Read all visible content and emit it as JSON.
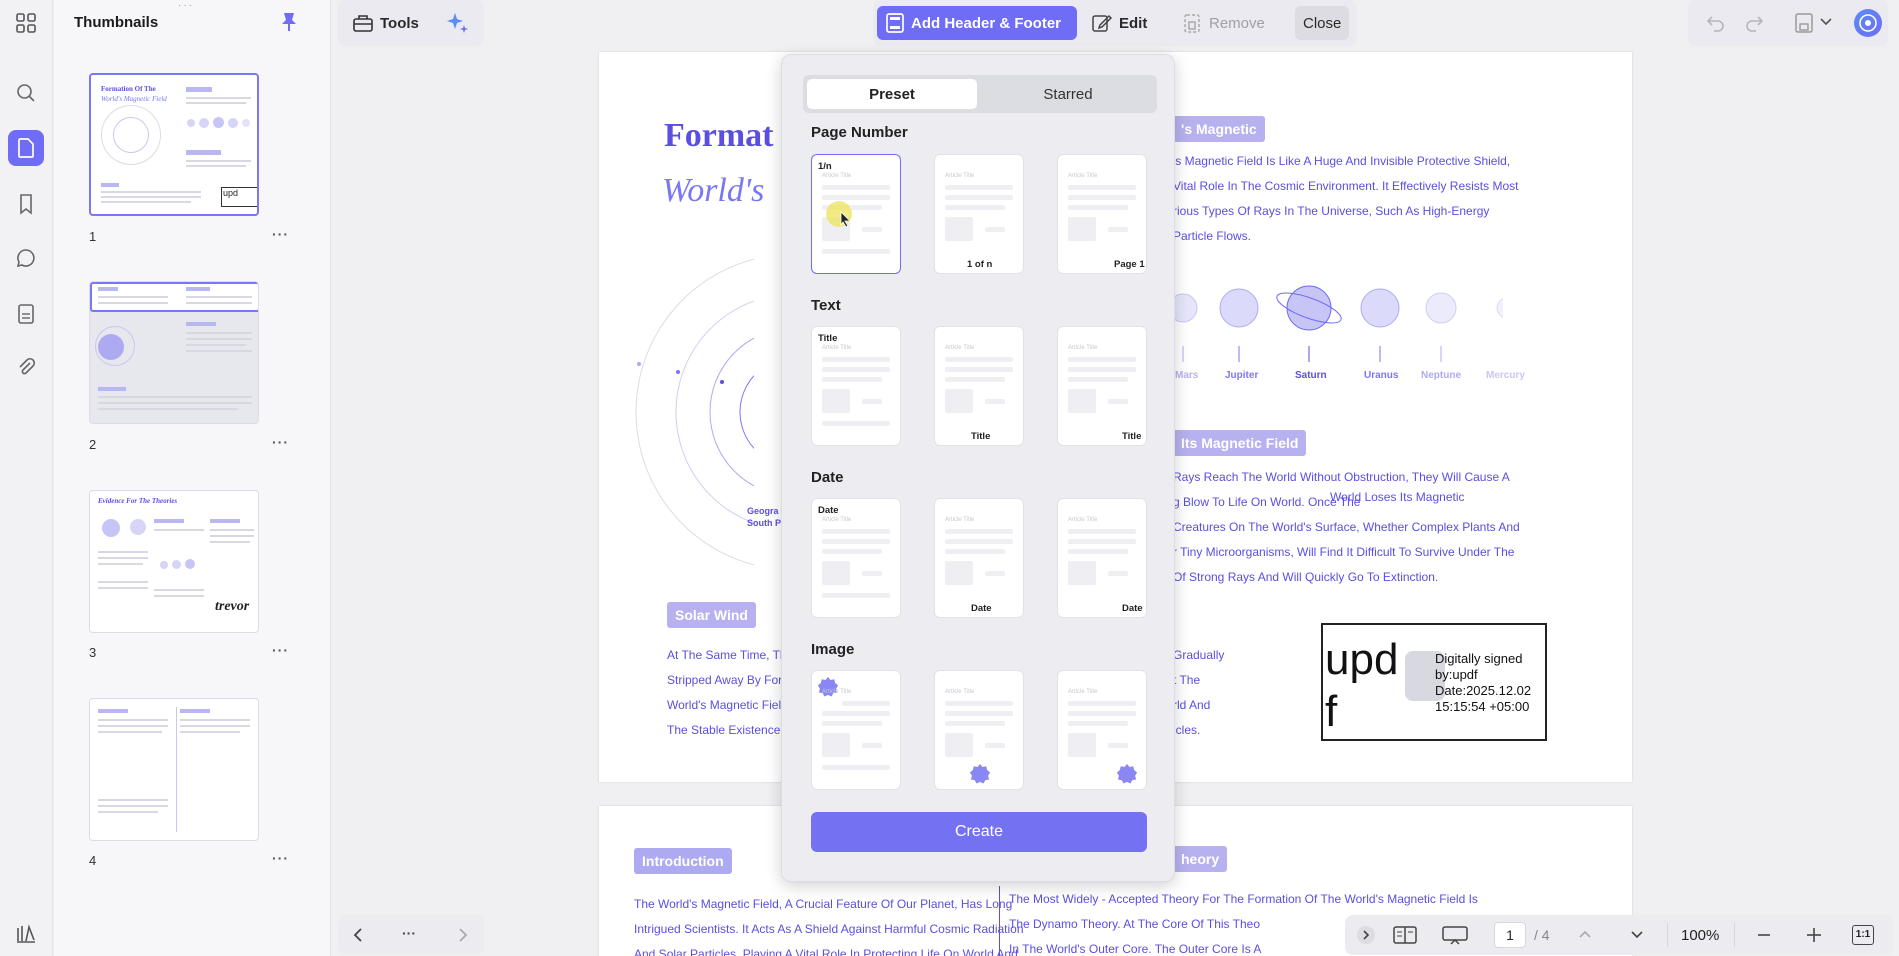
{
  "sidebar": {
    "title": "Thumbnails",
    "pages": [
      {
        "number": "1",
        "more": "···",
        "heading1": "Formation Of The",
        "heading2": "World's Magnetic Field"
      },
      {
        "number": "2",
        "more": "···"
      },
      {
        "number": "3",
        "more": "···",
        "heading": "Evidence For The Theories",
        "signature": "trevor"
      },
      {
        "number": "4",
        "more": "···"
      }
    ]
  },
  "toolbar": {
    "tools_label": "Tools",
    "add_header_footer_label": "Add Header & Footer",
    "edit_label": "Edit",
    "remove_label": "Remove",
    "close_label": "Close"
  },
  "panel": {
    "tabs": [
      "Preset",
      "Starred"
    ],
    "sections": [
      {
        "title": "Page Number",
        "captions": [
          "1/n",
          "1 of n",
          "Page 1"
        ]
      },
      {
        "title": "Text",
        "captions": [
          "Title",
          "Title",
          "Title"
        ]
      },
      {
        "title": "Date",
        "captions": [
          "Date",
          "Date",
          "Date"
        ]
      },
      {
        "title": "Image",
        "captions": [
          "",
          "",
          ""
        ]
      }
    ],
    "card_placeholder": "Article Title",
    "create_label": "Create"
  },
  "document": {
    "title1": "Format",
    "title2": "World's",
    "heading_magnetic": "'s Magnetic",
    "para1": [
      "'s Magnetic Field Is Like A Huge And Invisible Protective Shield,",
      "Vital Role In The Cosmic Environment. It Effectively Resists Most",
      "rious Types Of Rays In The Universe, Such As High-Energy",
      "Particle Flows."
    ],
    "planets": [
      "Mars",
      "Jupiter",
      "Saturn",
      "Uranus",
      "Neptune",
      "Mercury"
    ],
    "heading_field": "Its Magnetic Field",
    "para2": [
      "Rays Reach The World Without Obstruction, They Will Cause A",
      "g Blow To Life On World. Once The",
      "World Loses Its Magnetic",
      "Creatures On The World's Surface, Whether Complex Plants And",
      "r Tiny Microorganisms, Will Find It Difficult To Survive Under The",
      "Of Strong Rays And Will Quickly Go To Extinction."
    ],
    "geo_label1": "Geogra",
    "geo_label2": "South P",
    "solar_wind": "Solar Wind",
    "solar_lines": [
      "At The Same Time, Th",
      "Stripped Away By For",
      "World's Magnetic Fiel",
      "The Stable Existence"
    ],
    "right_lines": [
      "Gradually",
      "t The",
      "rld And",
      "icles."
    ],
    "signature": {
      "logo1": "upd",
      "logo2": "f",
      "line1": "Digitally signed",
      "line2": "by:updf",
      "line3": "Date:2025.12.02",
      "line4": "15:15:54 +05:00"
    },
    "intro_heading": "Introduction",
    "intro_lines": [
      "The World's Magnetic Field, A Crucial Feature Of Our Planet, Has Long",
      "Intrigued Scientists. It Acts As A Shield Against Harmful Cosmic Radiation",
      "And Solar Particles, Playing A Vital Role In Protecting Life On World And"
    ],
    "theory_heading": "heory",
    "theory_lines": [
      "The Most Widely - Accepted Theory For The Formation Of The World's Magnetic Field Is",
      "The Dynamo Theory. At The Core Of This Theo",
      "In The World's Outer Core. The Outer Core Is A"
    ]
  },
  "bottom": {
    "nav_more": "···",
    "page_current": "1",
    "page_total": "/ 4",
    "zoom": "100%",
    "fit_label": "1:1"
  },
  "colors": {
    "accent": "#6f6cf5",
    "doc_text": "#5a4fe0",
    "tag_bg": "#b7b2ef"
  }
}
